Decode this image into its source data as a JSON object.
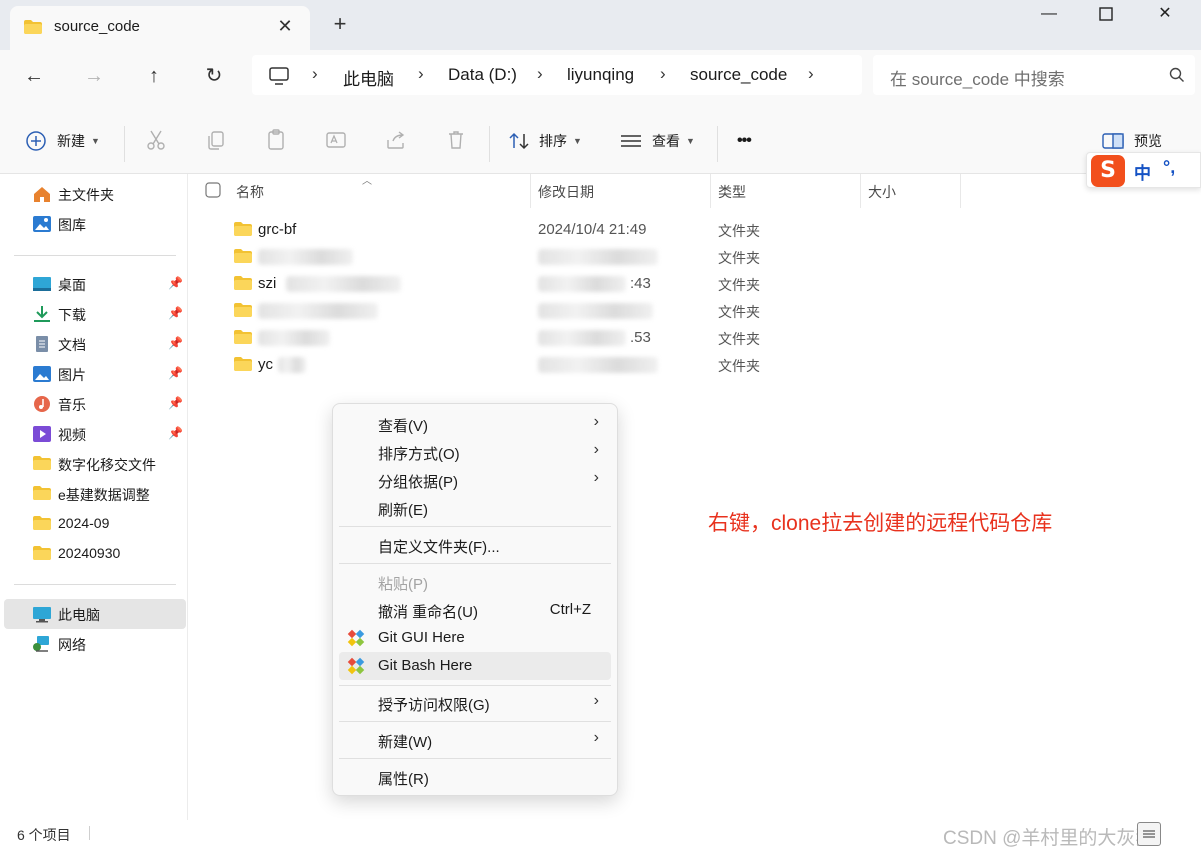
{
  "window": {
    "tab_title": "source_code",
    "new_tab": "+",
    "controls": {
      "minimize": "—",
      "maximize": "☐",
      "close": "✕"
    }
  },
  "nav": {
    "back": "←",
    "forward": "→",
    "up": "↑",
    "refresh": "↻"
  },
  "address": {
    "segments": [
      "此电脑",
      "Data (D:)",
      "liyunqing",
      "source_code"
    ]
  },
  "search": {
    "placeholder": "在 source_code 中搜索"
  },
  "toolbar": {
    "new_label": "新建",
    "sort_label": "排序",
    "view_label": "查看",
    "more_label": "•••",
    "preview_label": "预览"
  },
  "sidebar": {
    "top_items": [
      {
        "label": "主文件夹",
        "icon": "home-icon"
      },
      {
        "label": "图库",
        "icon": "gallery-icon"
      }
    ],
    "pinned_items": [
      {
        "label": "桌面",
        "icon": "desktop-icon"
      },
      {
        "label": "下载",
        "icon": "download-icon"
      },
      {
        "label": "文档",
        "icon": "document-icon"
      },
      {
        "label": "图片",
        "icon": "pictures-icon"
      },
      {
        "label": "音乐",
        "icon": "music-icon"
      },
      {
        "label": "视频",
        "icon": "video-icon"
      }
    ],
    "folders": [
      "数字化移交文件",
      "e基建数据调整",
      "2024-09",
      "20240930"
    ],
    "bottom_items": [
      {
        "label": "此电脑",
        "icon": "this-pc-icon",
        "selected": true
      },
      {
        "label": "网络",
        "icon": "network-icon"
      }
    ]
  },
  "file_list": {
    "columns": [
      "名称",
      "修改日期",
      "类型",
      "大小"
    ],
    "rows": [
      {
        "name": "grc-bf",
        "date": "2024/10/4 21:49",
        "type": "文件夹",
        "blurred": false
      },
      {
        "name": "",
        "date": "",
        "type": "文件夹",
        "blurred": true
      },
      {
        "name": "szi",
        "date": ":43",
        "type": "文件夹",
        "blurred": true
      },
      {
        "name": "",
        "date": "",
        "type": "文件夹",
        "blurred": true
      },
      {
        "name": "",
        "date": ".53",
        "type": "文件夹",
        "blurred": true
      },
      {
        "name": "yc",
        "date": "",
        "type": "文件夹",
        "blurred": true
      }
    ]
  },
  "context_menu": {
    "items": [
      {
        "label": "查看(V)",
        "submenu": true
      },
      {
        "label": "排序方式(O)",
        "submenu": true
      },
      {
        "label": "分组依据(P)",
        "submenu": true
      },
      {
        "label": "刷新(E)"
      },
      {
        "label": "自定义文件夹(F)..."
      },
      {
        "label": "粘贴(P)",
        "disabled": true
      },
      {
        "label": "撤消 重命名(U)",
        "shortcut": "Ctrl+Z"
      },
      {
        "label": "Git GUI Here",
        "icon": "git-gui-icon"
      },
      {
        "label": "Git Bash Here",
        "icon": "git-bash-icon",
        "hover": true
      },
      {
        "label": "授予访问权限(G)",
        "submenu": true
      },
      {
        "label": "新建(W)",
        "submenu": true
      },
      {
        "label": "属性(R)"
      }
    ],
    "submenu_arrow": "›"
  },
  "annotation": "右键，clone拉去创建的远程代码仓库",
  "status": {
    "item_count": "6 个项目",
    "watermark": "CSDN @羊村里的大灰狼"
  },
  "ime": {
    "logo": "S",
    "mode": "中",
    "punctuation": "°,"
  },
  "colors": {
    "annotation": "#e8321e",
    "folder": "#f2c233",
    "ime_logo": "#f24f1c",
    "ime_text": "#1452c4"
  }
}
